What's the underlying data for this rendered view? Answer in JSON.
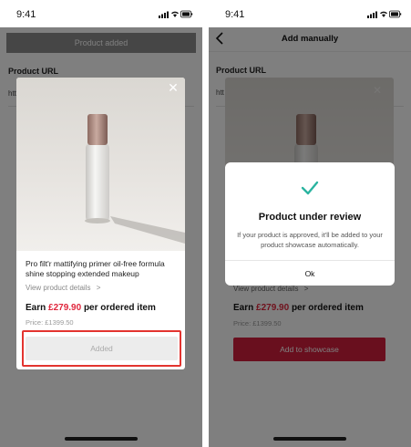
{
  "left_screen": {
    "status_time": "9:41",
    "toast": "Product added",
    "field_label": "Product URL",
    "field_value_partial": "htt",
    "modal": {
      "product_title": "Pro filt'r mattifying primer oil-free formula shine stopping extended makeup",
      "details_link": "View product details",
      "details_chevron": ">",
      "earn_prefix": "Earn ",
      "earn_amount": "£279.90",
      "earn_suffix": " per ordered item",
      "price": "Price: £1399.50",
      "added_button": "Added",
      "close_symbol": "✕"
    }
  },
  "right_screen": {
    "status_time": "9:41",
    "nav_title": "Add manually",
    "field_label": "Product URL",
    "field_value_partial": "htt",
    "background_card": {
      "close_symbol": "✕",
      "details_link": "View product details",
      "details_chevron": ">",
      "earn_prefix": "Earn ",
      "earn_amount": "£279.90",
      "earn_suffix": " per ordered item",
      "price": "Price: £1399.50",
      "add_button": "Add to showcase"
    },
    "dialog": {
      "title": "Product under review",
      "body": "If your product is approved, it'll be added to your product showcase automatically.",
      "ok_button": "Ok"
    }
  },
  "colors": {
    "accent_red": "#e0263c",
    "primary_button": "#d21f3c",
    "success_check": "#2bb4a0",
    "highlight_outline": "#e3342f"
  }
}
